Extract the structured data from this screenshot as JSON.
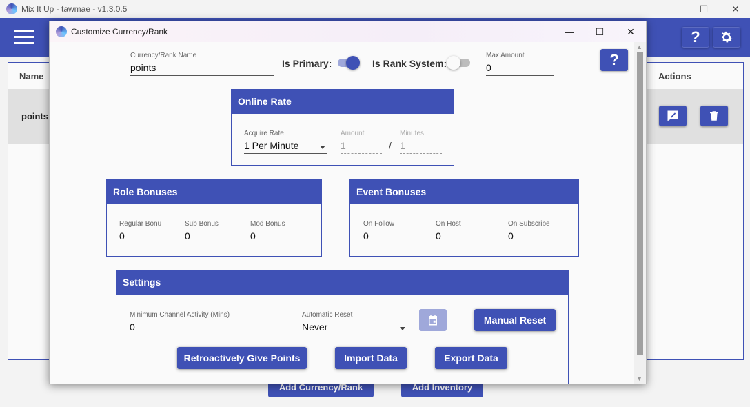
{
  "main_window": {
    "title": "Mix It Up - tawmae - v1.3.0.5",
    "controls": {
      "minimize": "—",
      "maximize": "☐",
      "close": "✕"
    },
    "appbar": {
      "help_label": "?",
      "menu_icon": "hamburger-icon",
      "settings_icon": "gear-icon"
    },
    "table": {
      "headers": {
        "name": "Name",
        "actions": "Actions"
      },
      "rows": [
        {
          "name": "points"
        }
      ]
    },
    "bottom_buttons": {
      "add_currency": "Add Currency/Rank",
      "add_inventory": "Add Inventory"
    }
  },
  "dialog": {
    "title": "Customize Currency/Rank",
    "controls": {
      "minimize": "—",
      "maximize": "☐",
      "close": "✕"
    },
    "help_label": "?",
    "name_field": {
      "label": "Currency/Rank Name",
      "value": "points"
    },
    "is_primary": {
      "label": "Is Primary:",
      "on": true
    },
    "is_rank_system": {
      "label": "Is Rank System:",
      "on": false
    },
    "max_amount": {
      "label": "Max Amount",
      "value": "0"
    },
    "online_rate": {
      "header": "Online Rate",
      "acquire_rate": {
        "label": "Acquire Rate",
        "value": "1 Per Minute"
      },
      "amount": {
        "label": "Amount",
        "value": "1"
      },
      "separator": "/",
      "minutes": {
        "label": "Minutes",
        "value": "1"
      }
    },
    "role_bonuses": {
      "header": "Role Bonuses",
      "regular": {
        "label": "Regular Bonu",
        "value": "0"
      },
      "sub": {
        "label": "Sub Bonus",
        "value": "0"
      },
      "mod": {
        "label": "Mod Bonus",
        "value": "0"
      }
    },
    "event_bonuses": {
      "header": "Event Bonuses",
      "follow": {
        "label": "On Follow",
        "value": "0"
      },
      "host": {
        "label": "On Host",
        "value": "0"
      },
      "subscribe": {
        "label": "On Subscribe",
        "value": "0"
      }
    },
    "settings": {
      "header": "Settings",
      "min_activity": {
        "label": "Minimum Channel Activity (Mins)",
        "value": "0"
      },
      "auto_reset": {
        "label": "Automatic Reset",
        "value": "Never"
      },
      "manual_reset": "Manual Reset",
      "retro_points": "Retroactively Give Points",
      "import_data": "Import Data",
      "export_data": "Export Data"
    }
  },
  "colors": {
    "primary": "#3f51b5",
    "disabled_primary": "#9fa8da"
  }
}
